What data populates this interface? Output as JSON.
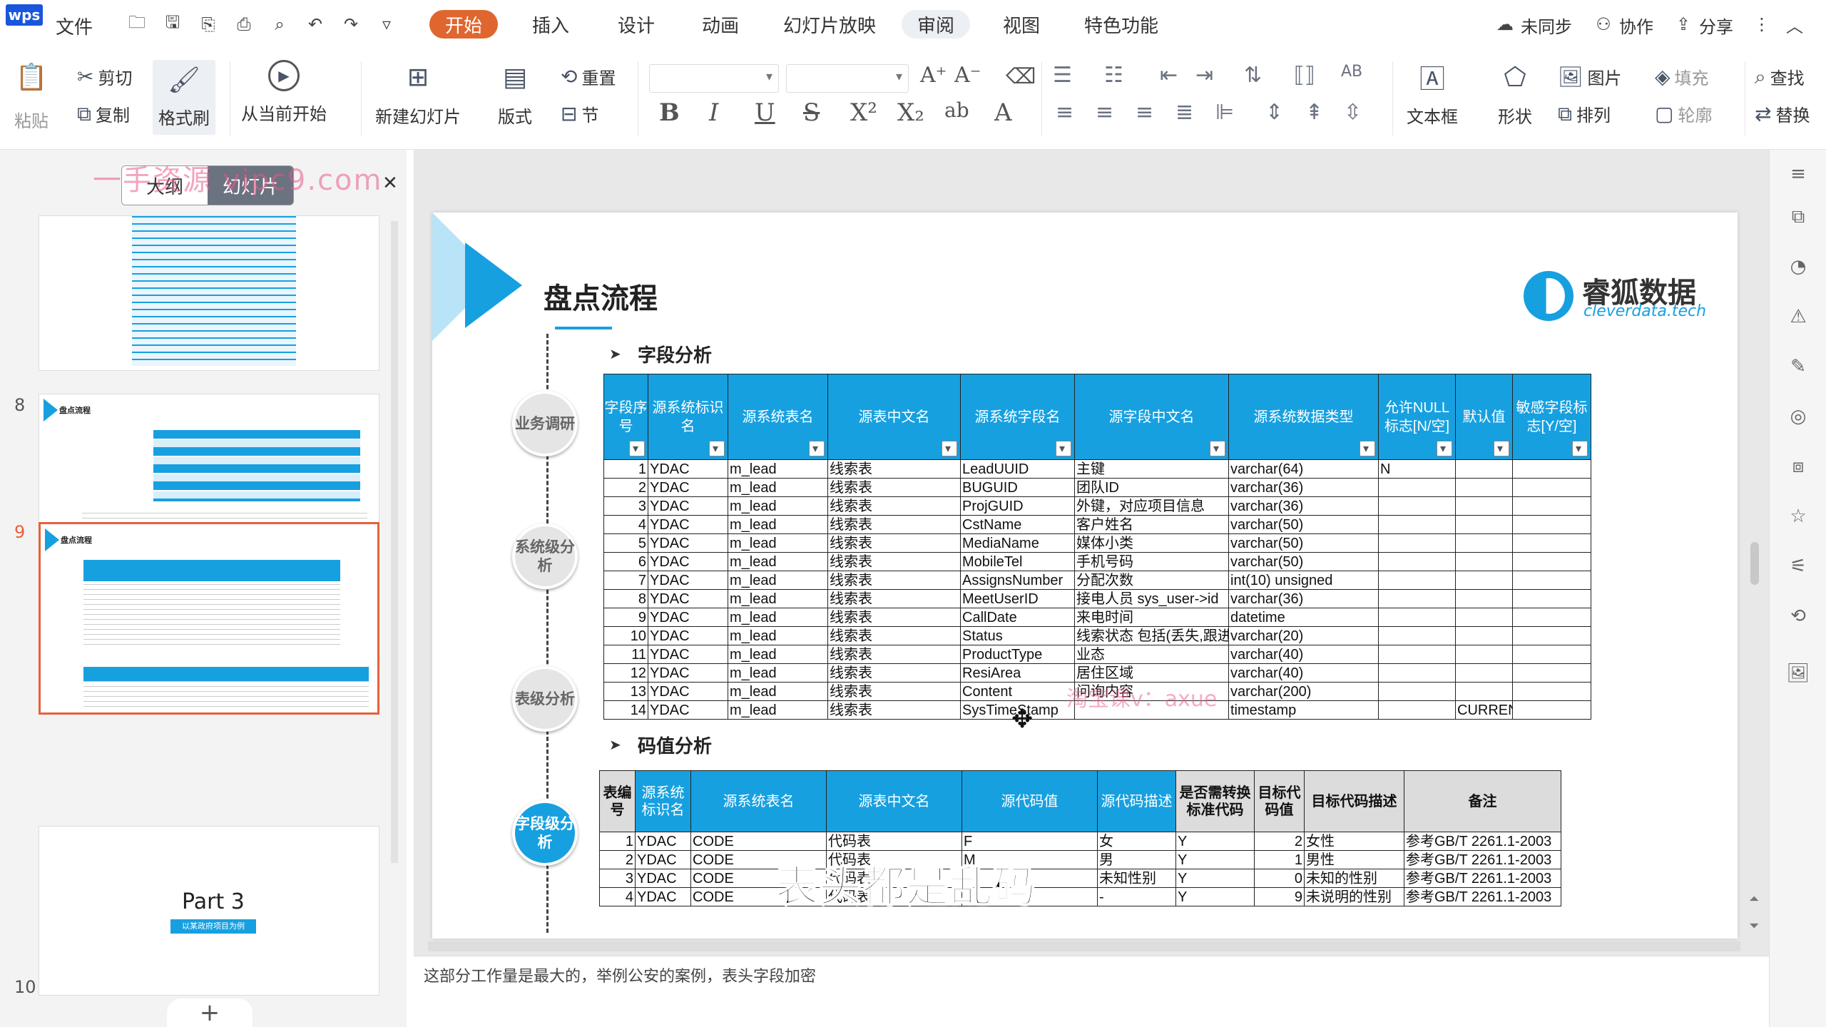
{
  "menubar": {
    "logo": "wps",
    "file": "文件",
    "tabs": [
      "开始",
      "插入",
      "设计",
      "动画",
      "幻灯片放映",
      "审阅",
      "视图",
      "特色功能"
    ],
    "unsync": "未同步",
    "collab": "协作",
    "share": "分享"
  },
  "ribbon": {
    "paste": "粘贴",
    "cut": "剪切",
    "copy": "复制",
    "format_painter": "格式刷",
    "from_current": "从当前开始",
    "new_slide": "新建幻灯片",
    "layout": "版式",
    "reset": "重置",
    "section": "节",
    "textbox": "文本框",
    "shape": "形状",
    "picture": "图片",
    "arrange": "排列",
    "fill": "填充",
    "outline": "轮廓",
    "find": "查找",
    "replace": "替换"
  },
  "left_panel": {
    "tab_outline": "大纲",
    "tab_slides": "幻灯片",
    "watermark": "一手资源 vipc9.com",
    "slides": [
      {
        "num": "8",
        "title": "盘点流程"
      },
      {
        "num": "9",
        "title": "盘点流程"
      },
      {
        "num": "10",
        "title": "Part 3",
        "subtitle": "以某政府项目为例"
      }
    ],
    "add": "+"
  },
  "slide": {
    "title": "盘点流程",
    "brand": "睿狐数据",
    "brand_sub": "cleverdata.tech",
    "section1": "字段分析",
    "section2": "码值分析",
    "circles": [
      "业务调研",
      "系统级分析",
      "表级分析",
      "字段级分析"
    ],
    "field_table": {
      "headers": [
        "字段序号",
        "源系统标识名",
        "源系统表名",
        "源表中文名",
        "源系统字段名",
        "源字段中文名",
        "源系统数据类型",
        "允许NULL标志[N/空]",
        "默认值",
        "敏感字段标志[Y/空]"
      ],
      "rows": [
        [
          "1",
          "YDAC",
          "m_lead",
          "线索表",
          "LeadUUID",
          "主键",
          "varchar(64)",
          "N",
          "",
          ""
        ],
        [
          "2",
          "YDAC",
          "m_lead",
          "线索表",
          "BUGUID",
          "团队ID",
          "varchar(36)",
          "",
          "",
          ""
        ],
        [
          "3",
          "YDAC",
          "m_lead",
          "线索表",
          "ProjGUID",
          "外键，对应项目信息",
          "varchar(36)",
          "",
          "",
          ""
        ],
        [
          "4",
          "YDAC",
          "m_lead",
          "线索表",
          "CstName",
          "客户姓名",
          "varchar(50)",
          "",
          "",
          ""
        ],
        [
          "5",
          "YDAC",
          "m_lead",
          "线索表",
          "MediaName",
          "媒体小类",
          "varchar(50)",
          "",
          "",
          ""
        ],
        [
          "6",
          "YDAC",
          "m_lead",
          "线索表",
          "MobileTel",
          "手机号码",
          "varchar(50)",
          "",
          "",
          ""
        ],
        [
          "7",
          "YDAC",
          "m_lead",
          "线索表",
          "AssignsNumber",
          "分配次数",
          "int(10) unsigned",
          "",
          "",
          ""
        ],
        [
          "8",
          "YDAC",
          "m_lead",
          "线索表",
          "MeetUserID",
          "接电人员 sys_user->id",
          "varchar(36)",
          "",
          "",
          ""
        ],
        [
          "9",
          "YDAC",
          "m_lead",
          "线索表",
          "CallDate",
          "来电时间",
          "datetime",
          "",
          "",
          ""
        ],
        [
          "10",
          "YDAC",
          "m_lead",
          "线索表",
          "Status",
          "线索状态 包括(丢失,跟进",
          "varchar(20)",
          "",
          "",
          ""
        ],
        [
          "11",
          "YDAC",
          "m_lead",
          "线索表",
          "ProductType",
          "业态",
          "varchar(40)",
          "",
          "",
          ""
        ],
        [
          "12",
          "YDAC",
          "m_lead",
          "线索表",
          "ResiArea",
          "居住区域",
          "varchar(40)",
          "",
          "",
          ""
        ],
        [
          "13",
          "YDAC",
          "m_lead",
          "线索表",
          "Content",
          "问询内容",
          "varchar(200)",
          "",
          "",
          ""
        ],
        [
          "14",
          "YDAC",
          "m_lead",
          "线索表",
          "SysTimeStamp",
          "",
          "timestamp",
          "",
          "CURRENT_TIMEST",
          ""
        ]
      ]
    },
    "code_table": {
      "headers": [
        "表编号",
        "源系统标识名",
        "源系统表名",
        "源表中文名",
        "源代码值",
        "源代码描述",
        "是否需转换标准代码",
        "目标代码值",
        "目标代码描述",
        "备注"
      ],
      "rows": [
        [
          "1",
          "YDAC",
          "CODE",
          "代码表",
          "F",
          "女",
          "Y",
          "2",
          "女性",
          "参考GB/T 2261.1-2003"
        ],
        [
          "2",
          "YDAC",
          "CODE",
          "代码表",
          "M",
          "男",
          "Y",
          "1",
          "男性",
          "参考GB/T 2261.1-2003"
        ],
        [
          "3",
          "YDAC",
          "CODE",
          "代码表",
          "",
          "未知性别",
          "Y",
          "0",
          "未知的性别",
          "参考GB/T 2261.1-2003"
        ],
        [
          "4",
          "YDAC",
          "CODE",
          "代码表",
          "",
          "-",
          "Y",
          "9",
          "未说明的性别",
          "参考GB/T 2261.1-2003"
        ]
      ]
    },
    "subtitle": "表头都是乱码",
    "watermark": "淘宝课v：axue"
  },
  "notes": "这部分工作量是最大的，举例公安的案例，表头字段加密"
}
